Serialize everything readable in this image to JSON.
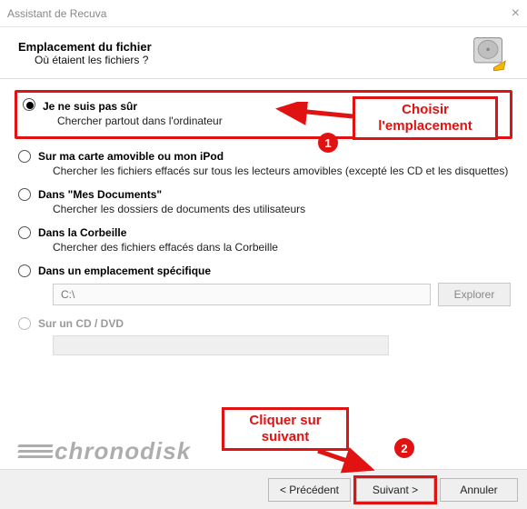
{
  "window": {
    "title": "Assistant de Recuva"
  },
  "header": {
    "title": "Emplacement du fichier",
    "subtitle": "Où étaient les fichiers ?"
  },
  "options": {
    "not_sure": {
      "label": "Je ne suis pas sûr",
      "desc": "Chercher partout dans l'ordinateur"
    },
    "removable": {
      "label": "Sur ma carte amovible ou mon iPod",
      "desc": "Chercher les fichiers effacés sur tous les lecteurs amovibles (excepté les CD et les disquettes)"
    },
    "documents": {
      "label": "Dans \"Mes Documents\"",
      "desc": "Chercher les dossiers de documents des utilisateurs"
    },
    "recycle": {
      "label": "Dans la Corbeille",
      "desc": "Chercher des fichiers effacés dans la Corbeille"
    },
    "specific": {
      "label": "Dans un emplacement spécifique",
      "path_placeholder": "C:\\",
      "browse": "Explorer"
    },
    "cddvd": {
      "label": "Sur un CD / DVD"
    }
  },
  "footer": {
    "back": "< Précédent",
    "next": "Suivant >",
    "cancel": "Annuler"
  },
  "annotations": {
    "a1_text": "Choisir l'emplacement",
    "a1_badge": "1",
    "a2_text": "Cliquer sur suivant",
    "a2_badge": "2"
  },
  "watermark": {
    "text": "chronodisk"
  }
}
